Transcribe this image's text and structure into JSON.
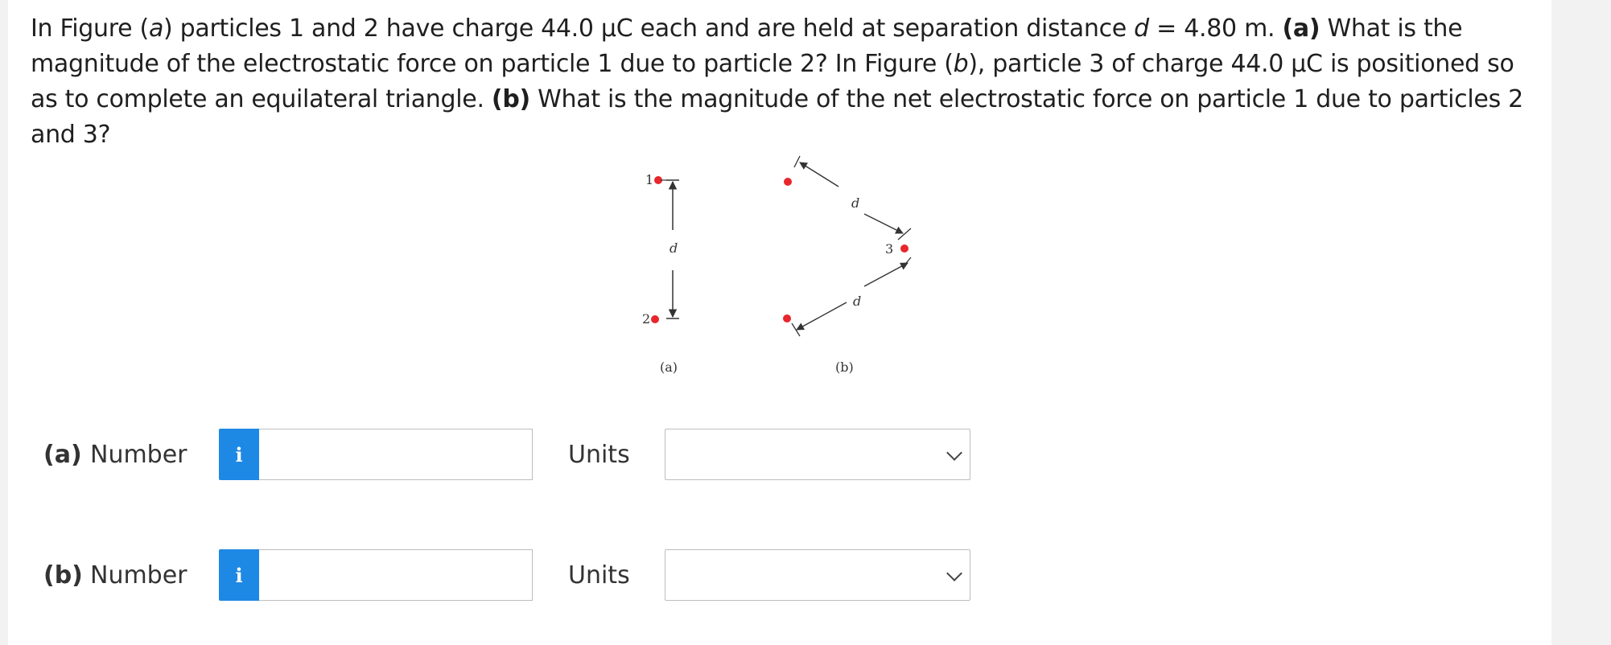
{
  "question": {
    "s1": "In Figure (",
    "s2": "a",
    "s3": ") particles 1 and 2 have charge 44.0 μC each and are held at separation distance ",
    "s4": "d",
    "s5": " = 4.80 m. ",
    "s6": "(a)",
    "s7": " What is the magnitude of the electrostatic force on particle 1 due to particle 2? In Figure (",
    "s8": "b",
    "s9": "), particle 3 of charge 44.0 μC is positioned so as to complete an equilateral triangle. ",
    "s10": "(b)",
    "s11": " What is the magnitude of the net electrostatic force on particle 1 due to particles 2 and 3?"
  },
  "figure": {
    "label_1": "1",
    "label_2": "2",
    "label_3": "3",
    "label_d": "d",
    "caption_a": "(a)",
    "caption_b": "(b)",
    "particle_color": "#e8262b"
  },
  "parts": [
    {
      "part_label": "(a)",
      "number_label": "Number",
      "info_icon": "i",
      "number_value": "",
      "units_label": "Units",
      "units_value": ""
    },
    {
      "part_label": "(b)",
      "number_label": "Number",
      "info_icon": "i",
      "number_value": "",
      "units_label": "Units",
      "units_value": ""
    }
  ],
  "colors": {
    "info_button": "#1e88e5"
  }
}
